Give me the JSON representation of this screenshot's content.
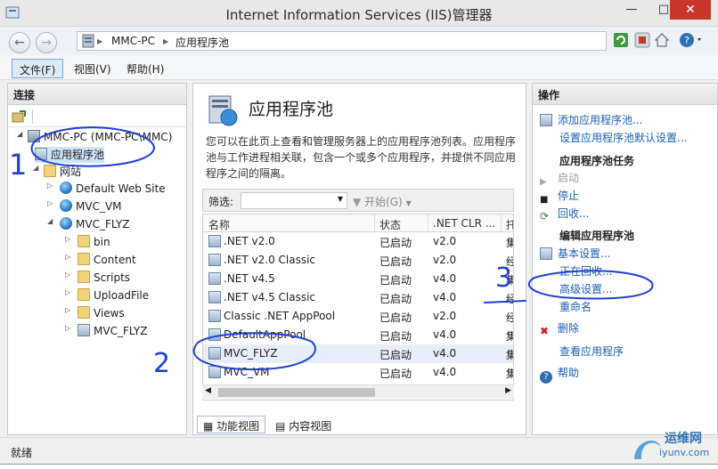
{
  "window": {
    "title": "Internet Information Services (IIS)管理器",
    "controls": {
      "minimize": "—",
      "maximize": "□",
      "close": "✕"
    }
  },
  "address": {
    "crumbs": [
      "MMC-PC",
      "应用程序池"
    ],
    "separator": "▶"
  },
  "menu": [
    "文件(F)",
    "视图(V)",
    "帮助(H)"
  ],
  "left": {
    "title": "连接",
    "tree": [
      "MMC-PC (MMC-PC\\MMC)",
      "应用程序池",
      "网站",
      "Default Web Site",
      "MVC_VM",
      "MVC_FLYZ",
      "bin",
      "Content",
      "Scripts",
      "UploadFile",
      "Views",
      "MVC_FLYZ"
    ]
  },
  "center": {
    "title": "应用程序池",
    "description": "您可以在此页上查看和管理服务器上的应用程序池列表。应用程序池与工作进程相关联，包含一个或多个应用程序，并提供不同应用程序之间的隔离。",
    "filter_label": "筛选:",
    "start_label": "开始(G)",
    "columns": [
      "名称",
      "状态",
      ".NET CLR ...",
      "托"
    ],
    "rows": [
      {
        "name": ".NET v2.0",
        "status": "已启动",
        "clr": "v2.0",
        "mode": "集"
      },
      {
        "name": ".NET v2.0 Classic",
        "status": "已启动",
        "clr": "v2.0",
        "mode": "经"
      },
      {
        "name": ".NET v4.5",
        "status": "已启动",
        "clr": "v4.0",
        "mode": "集"
      },
      {
        "name": ".NET v4.5 Classic",
        "status": "已启动",
        "clr": "v4.0",
        "mode": "经"
      },
      {
        "name": "Classic .NET AppPool",
        "status": "已启动",
        "clr": "v2.0",
        "mode": "经"
      },
      {
        "name": "DefaultAppPool",
        "status": "已启动",
        "clr": "v4.0",
        "mode": "集"
      },
      {
        "name": "MVC_FLYZ",
        "status": "已启动",
        "clr": "v4.0",
        "mode": "集"
      },
      {
        "name": "MVC_VM",
        "status": "已启动",
        "clr": "v4.0",
        "mode": "集"
      }
    ],
    "tabs": [
      "功能视图",
      "内容视图"
    ]
  },
  "right": {
    "title": "操作",
    "add_pool": "添加应用程序池...",
    "defaults": "设置应用程序池默认设置...",
    "tasks_heading": "应用程序池任务",
    "start": "启动",
    "stop": "停止",
    "recycle": "回收...",
    "edit_heading": "编辑应用程序池",
    "basic": "基本设置...",
    "recycling": "正在回收...",
    "advanced": "高级设置...",
    "rename": "重命名",
    "delete": "删除",
    "view_apps": "查看应用程序",
    "help": "帮助"
  },
  "status": "就绪",
  "annotations": [
    "1",
    "2",
    "3"
  ],
  "watermark": {
    "line1": "运维网",
    "line2": "iyunv.com"
  },
  "colors": {
    "accent": "#1a5fb4",
    "ink": "#1f3fd6",
    "close": "#c7352b"
  }
}
